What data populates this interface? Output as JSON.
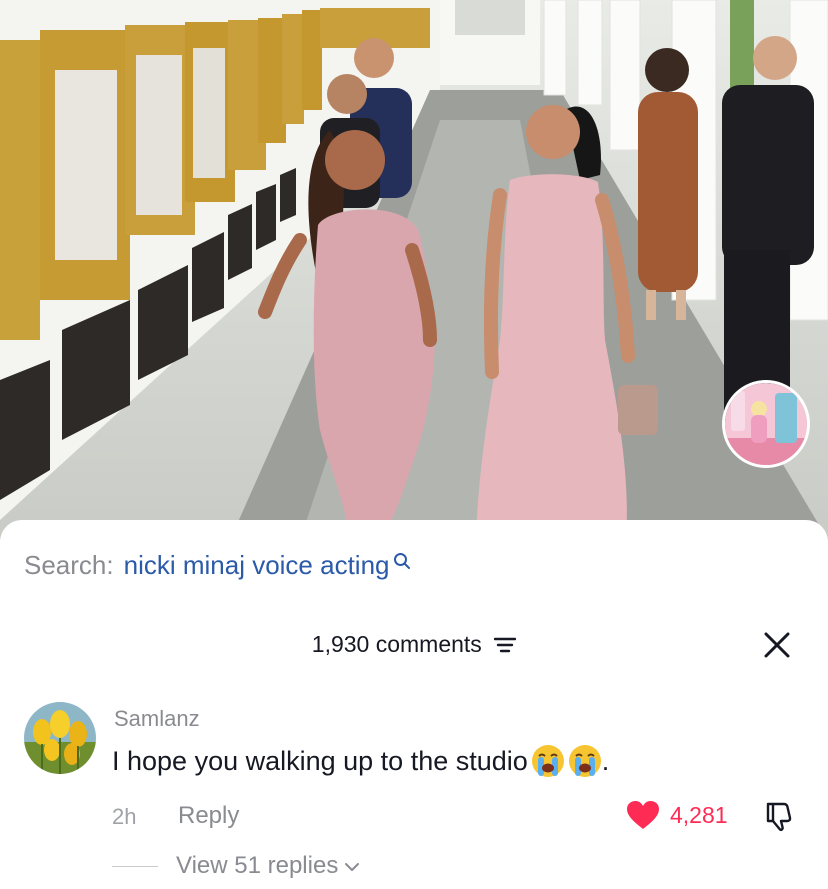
{
  "video": {
    "description_icon": "album-cover-thumbnail"
  },
  "search": {
    "label": "Search:",
    "query": "nicki minaj voice acting",
    "icon": "search-icon"
  },
  "comments_panel": {
    "count_label": "1,930 comments",
    "sort_icon": "sort-icon",
    "close_icon": "close-icon"
  },
  "comment": {
    "username": "Samlanz",
    "text": "I hope you walking up to the studio",
    "trailing": ".",
    "emojis": [
      "loudly-crying-face",
      "loudly-crying-face"
    ],
    "time": "2h",
    "reply_label": "Reply",
    "like_count": "4,281",
    "liked": true,
    "view_replies_label": "View 51 replies"
  },
  "colors": {
    "accent_red": "#fe2c55",
    "link_blue": "#2b5aa8",
    "muted_text": "#8a8b91",
    "primary_text": "#161823"
  }
}
